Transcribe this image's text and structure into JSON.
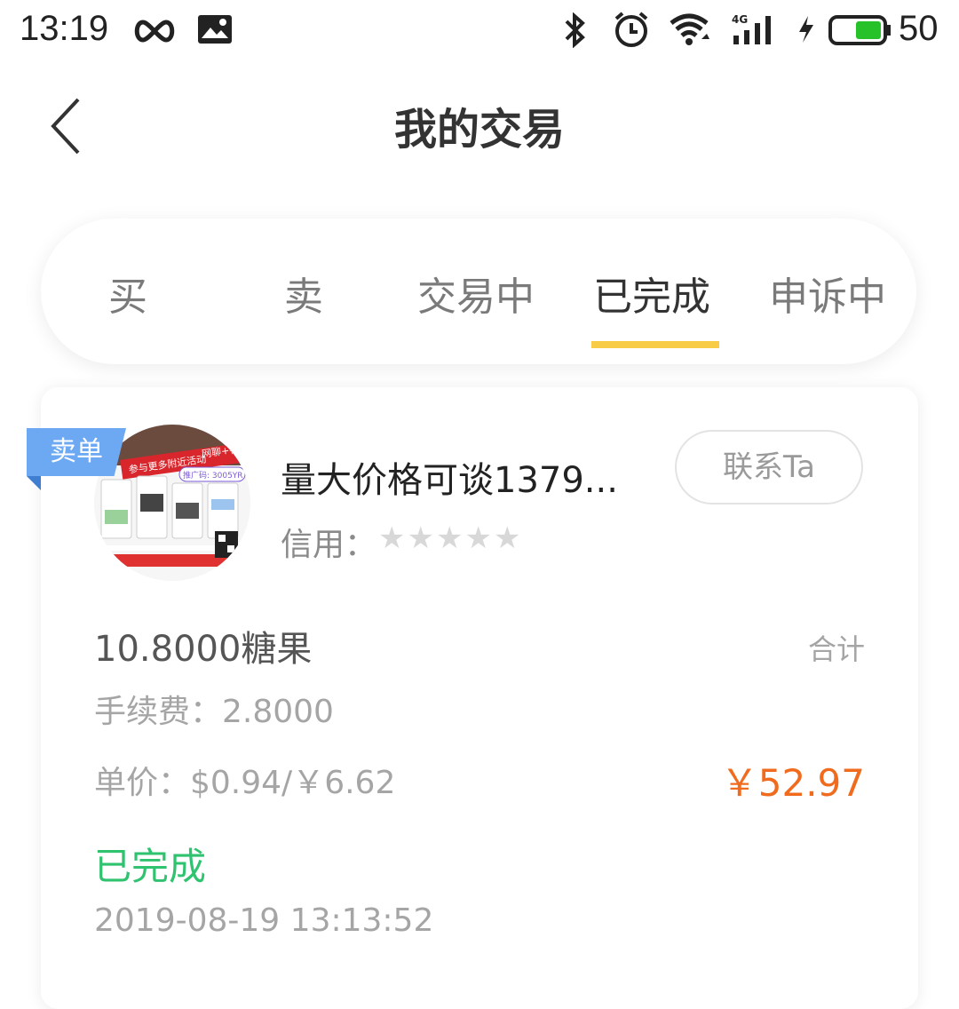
{
  "status_bar": {
    "time": "13:19",
    "battery_percent": "50",
    "icons": [
      "infinity-icon",
      "image-icon",
      "bluetooth-icon",
      "alarm-icon",
      "wifi-icon",
      "signal-4g-icon",
      "charging-icon",
      "battery-icon"
    ]
  },
  "header": {
    "title": "我的交易",
    "back_icon": "back-chevron-icon"
  },
  "tabs": [
    {
      "label": "买"
    },
    {
      "label": "卖"
    },
    {
      "label": "交易中"
    },
    {
      "label": "已完成",
      "active": true
    },
    {
      "label": "申诉中"
    }
  ],
  "colors": {
    "accent": "#f8cc46",
    "sell_badge": "#6da8f3",
    "price": "#f06b1e",
    "status_done": "#2fc26f"
  },
  "trade": {
    "badge": "卖单",
    "title": "量大价格可谈1379...",
    "contact_label": "联系Ta",
    "credit_label": "信用：",
    "credit_stars_filled": 0,
    "credit_stars_total": 5,
    "amount": "10.8000糖果",
    "total_label": "合计",
    "fee": "手续费：2.8000",
    "unit_price": "单价：$0.94/￥6.62",
    "total_value": "￥52.97",
    "status": "已完成",
    "timestamp": "2019-08-19 13:13:52",
    "avatar_banner_text": "参与更多附近活动",
    "avatar_banner_text2": "网聊+社",
    "avatar_code_text": "推广码: 3005YR"
  }
}
